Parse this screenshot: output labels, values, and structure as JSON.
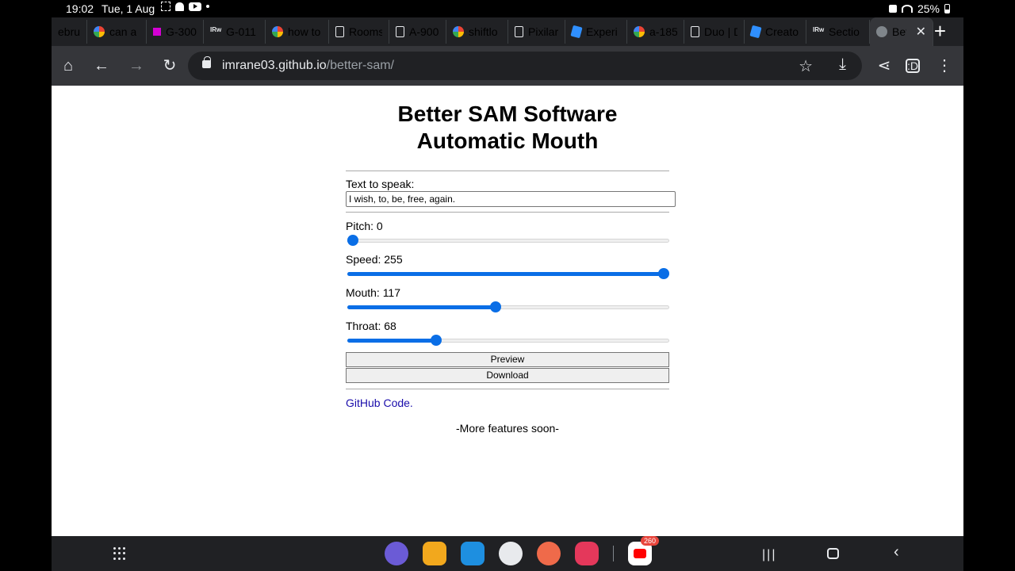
{
  "status_bar": {
    "time": "19:02",
    "date": "Tue, 1 Aug",
    "battery": "25%"
  },
  "tabs": [
    {
      "label": "ebrua",
      "icon": "doc-icon"
    },
    {
      "label": "can a",
      "icon": "google-icon"
    },
    {
      "label": "G-300",
      "icon": "pixilart-icon"
    },
    {
      "label": "G-011",
      "icon": "rw-icon"
    },
    {
      "label": "how to",
      "icon": "google-icon"
    },
    {
      "label": "Rooms",
      "icon": "doc-icon"
    },
    {
      "label": "A-900",
      "icon": "doc-icon"
    },
    {
      "label": "shiftlo",
      "icon": "google-icon"
    },
    {
      "label": "Pixilar",
      "icon": "doc-icon"
    },
    {
      "label": "Experi",
      "icon": "roblox-icon"
    },
    {
      "label": "a-185",
      "icon": "google-icon"
    },
    {
      "label": "Duo | D",
      "icon": "doc-icon"
    },
    {
      "label": "Creato",
      "icon": "roblox-icon"
    },
    {
      "label": "Sectio",
      "icon": "rw-icon"
    },
    {
      "label": "Bet",
      "icon": "globe-icon",
      "active": true
    }
  ],
  "toolbar": {
    "url_host": "imrane03.github.io",
    "url_path": "/better-sam/"
  },
  "page": {
    "title_line1": "Better SAM Software",
    "title_line2": "Automatic Mouth",
    "text_label": "Text to speak:",
    "text_value": "I wish, to, be, free, again.",
    "sliders": [
      {
        "name": "Pitch",
        "label": "Pitch: 0",
        "value": 0,
        "max": 255
      },
      {
        "name": "Speed",
        "label": "Speed: 255",
        "value": 255,
        "max": 255
      },
      {
        "name": "Mouth",
        "label": "Mouth: 117",
        "value": 117,
        "max": 255
      },
      {
        "name": "Throat",
        "label": "Throat: 68",
        "value": 68,
        "max": 255
      }
    ],
    "preview_label": "Preview",
    "download_label": "Download",
    "github_label": "GitHub Code.",
    "more_label": "-More features soon-"
  },
  "navbar": {
    "youtube_badge": "260"
  },
  "colors": {
    "accent": "#0a6ee6",
    "link": "#1a0dab",
    "browser_chrome": "#35363a"
  }
}
